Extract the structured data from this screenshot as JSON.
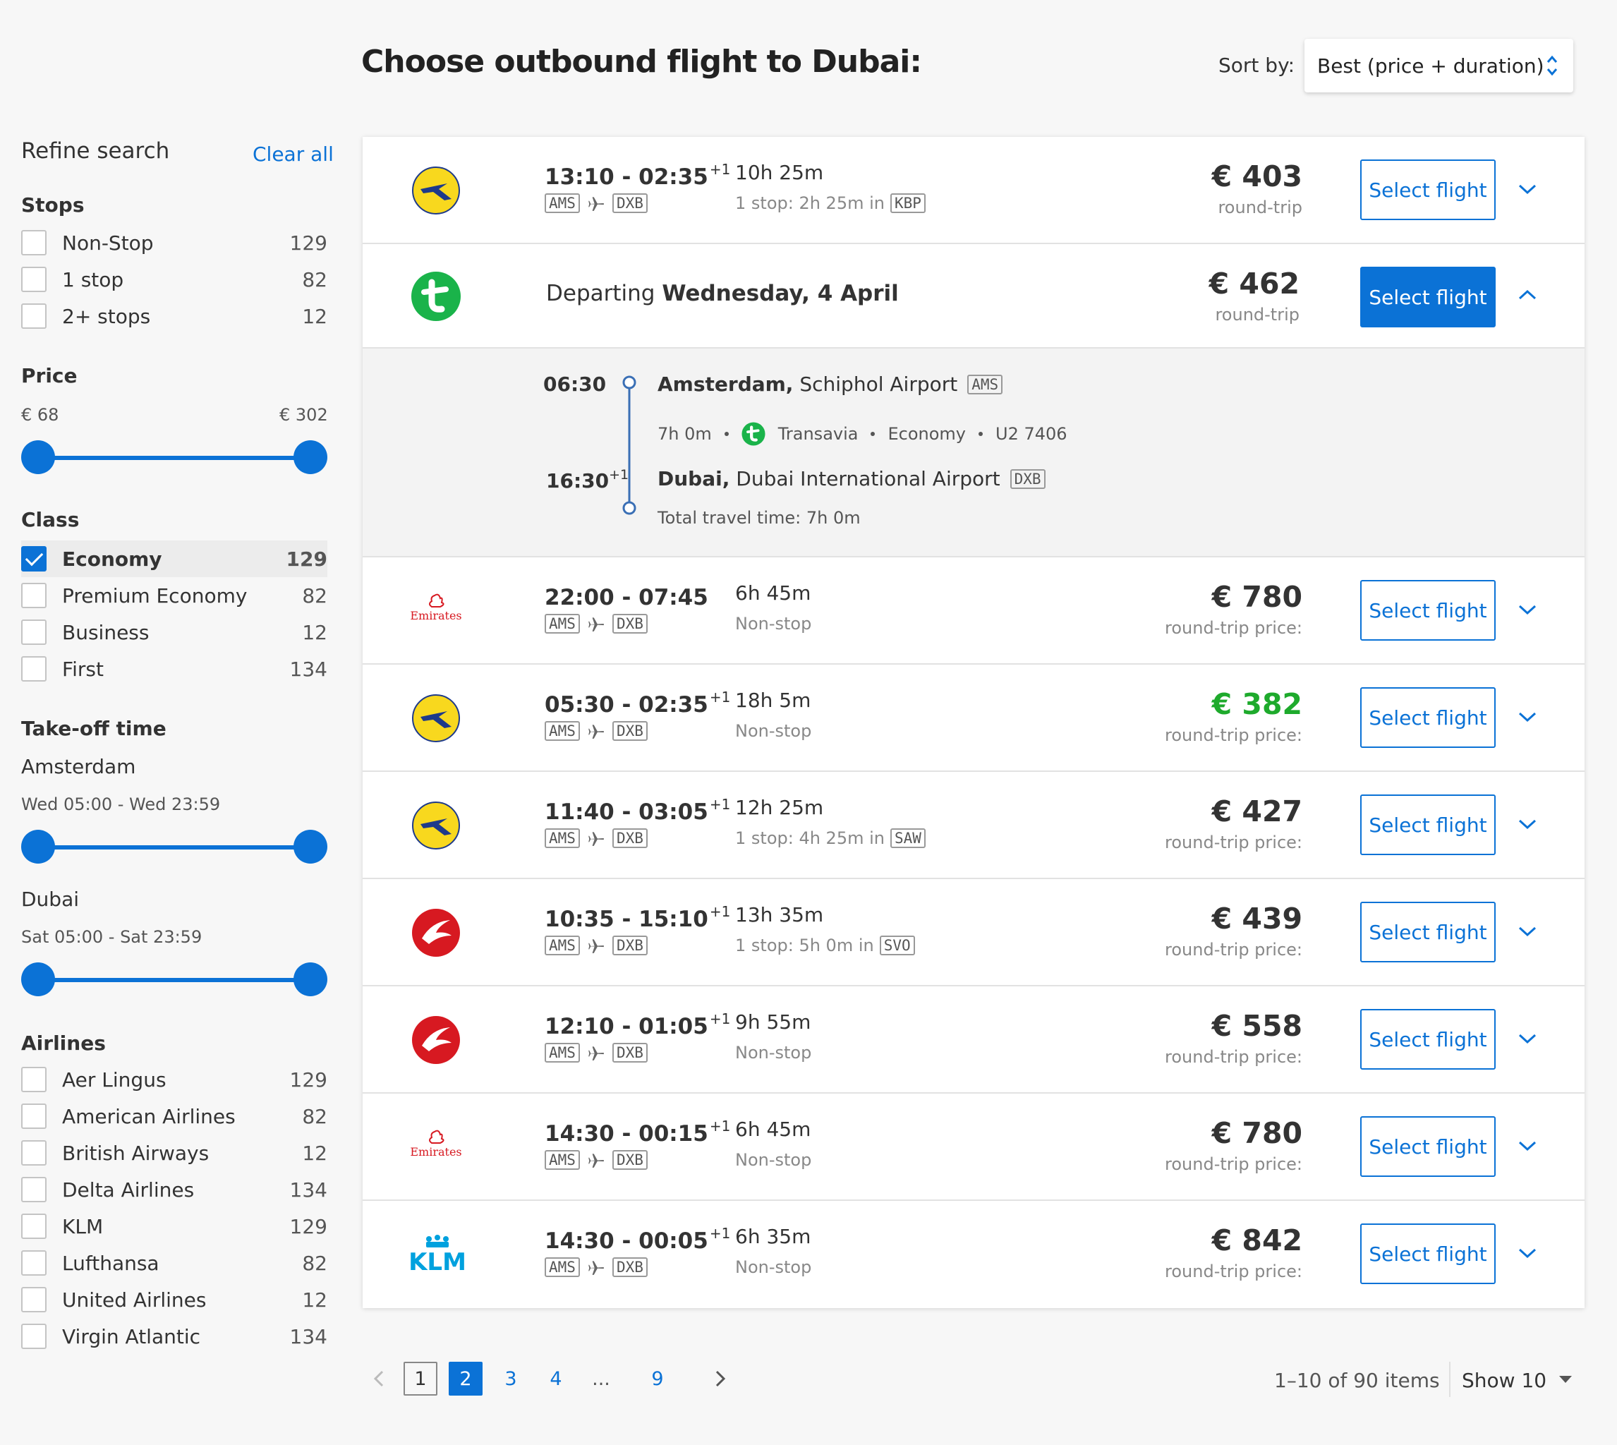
{
  "header": {
    "title": "Choose outbound flight to Dubai:",
    "sort_label": "Sort by:",
    "sort_value": "Best (price + duration)"
  },
  "sidebar": {
    "title": "Refine search",
    "clear_all": "Clear all",
    "stops": {
      "title": "Stops",
      "items": [
        {
          "label": "Non-Stop",
          "count": "129",
          "checked": false
        },
        {
          "label": "1 stop",
          "count": "82",
          "checked": false
        },
        {
          "label": "2+ stops",
          "count": "12",
          "checked": false
        }
      ]
    },
    "price": {
      "title": "Price",
      "min": "€ 68",
      "max": "€ 302"
    },
    "class": {
      "title": "Class",
      "items": [
        {
          "label": "Economy",
          "count": "129",
          "checked": true
        },
        {
          "label": "Premium Economy",
          "count": "82",
          "checked": false
        },
        {
          "label": "Business",
          "count": "12",
          "checked": false
        },
        {
          "label": "First",
          "count": "134",
          "checked": false
        }
      ]
    },
    "takeoff": {
      "title": "Take-off time",
      "origin": "Amsterdam",
      "origin_range": "Wed 05:00 - Wed 23:59",
      "destination": "Dubai",
      "destination_range": "Sat 05:00 - Sat 23:59"
    },
    "airlines": {
      "title": "Airlines",
      "items": [
        {
          "label": "Aer Lingus",
          "count": "129",
          "checked": false
        },
        {
          "label": "American Airlines",
          "count": "82",
          "checked": false
        },
        {
          "label": "British Airways",
          "count": "12",
          "checked": false
        },
        {
          "label": "Delta Airlines",
          "count": "134",
          "checked": false
        },
        {
          "label": "KLM",
          "count": "129",
          "checked": false
        },
        {
          "label": "Lufthansa",
          "count": "82",
          "checked": false
        },
        {
          "label": "United Airlines",
          "count": "12",
          "checked": false
        },
        {
          "label": "Virgin Atlantic",
          "count": "134",
          "checked": false
        }
      ]
    }
  },
  "results": {
    "select_label": "Select flight",
    "row1": {
      "airline_icon": "ukraine-airlines-logo",
      "times": "13:10 - 02:35",
      "plus": "+1",
      "from": "AMS",
      "to": "DXB",
      "duration": "10h 25m",
      "stops": "1 stop: 2h 25m in",
      "via": "KBP",
      "price": "€ 403",
      "price_sub": "round-trip"
    },
    "expanded": {
      "airline_icon": "transavia-logo",
      "departing_prefix": "Departing",
      "departing_date": "Wednesday, 4 April",
      "price": "€ 462",
      "price_sub": "round-trip",
      "dep_time": "06:30",
      "dep_city": "Amsterdam,",
      "dep_airport": "Schiphol Airport",
      "dep_code": "AMS",
      "flight_duration": "7h 0m",
      "carrier": "Transavia",
      "cabin": "Economy",
      "flight_no": "U2 7406",
      "arr_time": "16:30",
      "arr_plus": "+1",
      "arr_city": "Dubai,",
      "arr_airport": "Dubai International Airport",
      "arr_code": "DXB",
      "total": "Total travel time: 7h 0m"
    },
    "row3": {
      "airline_icon": "emirates-logo",
      "logo_text": "Emirates",
      "times": "22:00 - 07:45",
      "plus": "",
      "from": "AMS",
      "to": "DXB",
      "duration": "6h 45m",
      "stops": "Non-stop",
      "via": "",
      "price": "€ 780",
      "price_sub": "round-trip price:"
    },
    "row4": {
      "airline_icon": "ukraine-airlines-logo",
      "times": "05:30 - 02:35",
      "plus": "+1",
      "from": "AMS",
      "to": "DXB",
      "duration": "18h 5m",
      "stops": "Non-stop",
      "via": "",
      "price": "€ 382",
      "price_sub": "round-trip price:",
      "price_color": "#1eaa2c"
    },
    "row5": {
      "airline_icon": "ukraine-airlines-logo",
      "times": "11:40 - 03:05",
      "plus": "+1",
      "from": "AMS",
      "to": "DXB",
      "duration": "12h 25m",
      "stops": "1 stop: 4h 25m in",
      "via": "SAW",
      "price": "€ 427",
      "price_sub": "round-trip price:"
    },
    "row6": {
      "airline_icon": "turkish-airlines-logo",
      "times": "10:35 - 15:10",
      "plus": "+1",
      "from": "AMS",
      "to": "DXB",
      "duration": "13h 35m",
      "stops": "1 stop: 5h 0m in",
      "via": "SVO",
      "price": "€ 439",
      "price_sub": "round-trip price:"
    },
    "row7": {
      "airline_icon": "turkish-airlines-logo",
      "times": "12:10 - 01:05",
      "plus": "+1",
      "from": "AMS",
      "to": "DXB",
      "duration": "9h 55m",
      "stops": "Non-stop",
      "via": "",
      "price": "€ 558",
      "price_sub": "round-trip price:"
    },
    "row8": {
      "airline_icon": "emirates-logo",
      "logo_text": "Emirates",
      "times": "14:30 - 00:15",
      "plus": "+1",
      "from": "AMS",
      "to": "DXB",
      "duration": "6h 45m",
      "stops": "Non-stop",
      "via": "",
      "price": "€ 780",
      "price_sub": "round-trip price:"
    },
    "row9": {
      "airline_icon": "klm-logo",
      "logo_text": "KLM",
      "times": "14:30 - 00:05",
      "plus": "+1",
      "from": "AMS",
      "to": "DXB",
      "duration": "6h 35m",
      "stops": "Non-stop",
      "via": "",
      "price": "€ 842",
      "price_sub": "round-trip price:"
    }
  },
  "pagination": {
    "pages": [
      "1",
      "2",
      "3",
      "4",
      "...",
      "9"
    ],
    "current": "2",
    "info": "1–10 of 90 items",
    "show": "Show 10"
  },
  "colors": {
    "accent": "#0b72d6",
    "green_price": "#1eaa2c",
    "transavia": "#1ab34a",
    "emirates": "#d71921",
    "klm": "#00a1de"
  }
}
